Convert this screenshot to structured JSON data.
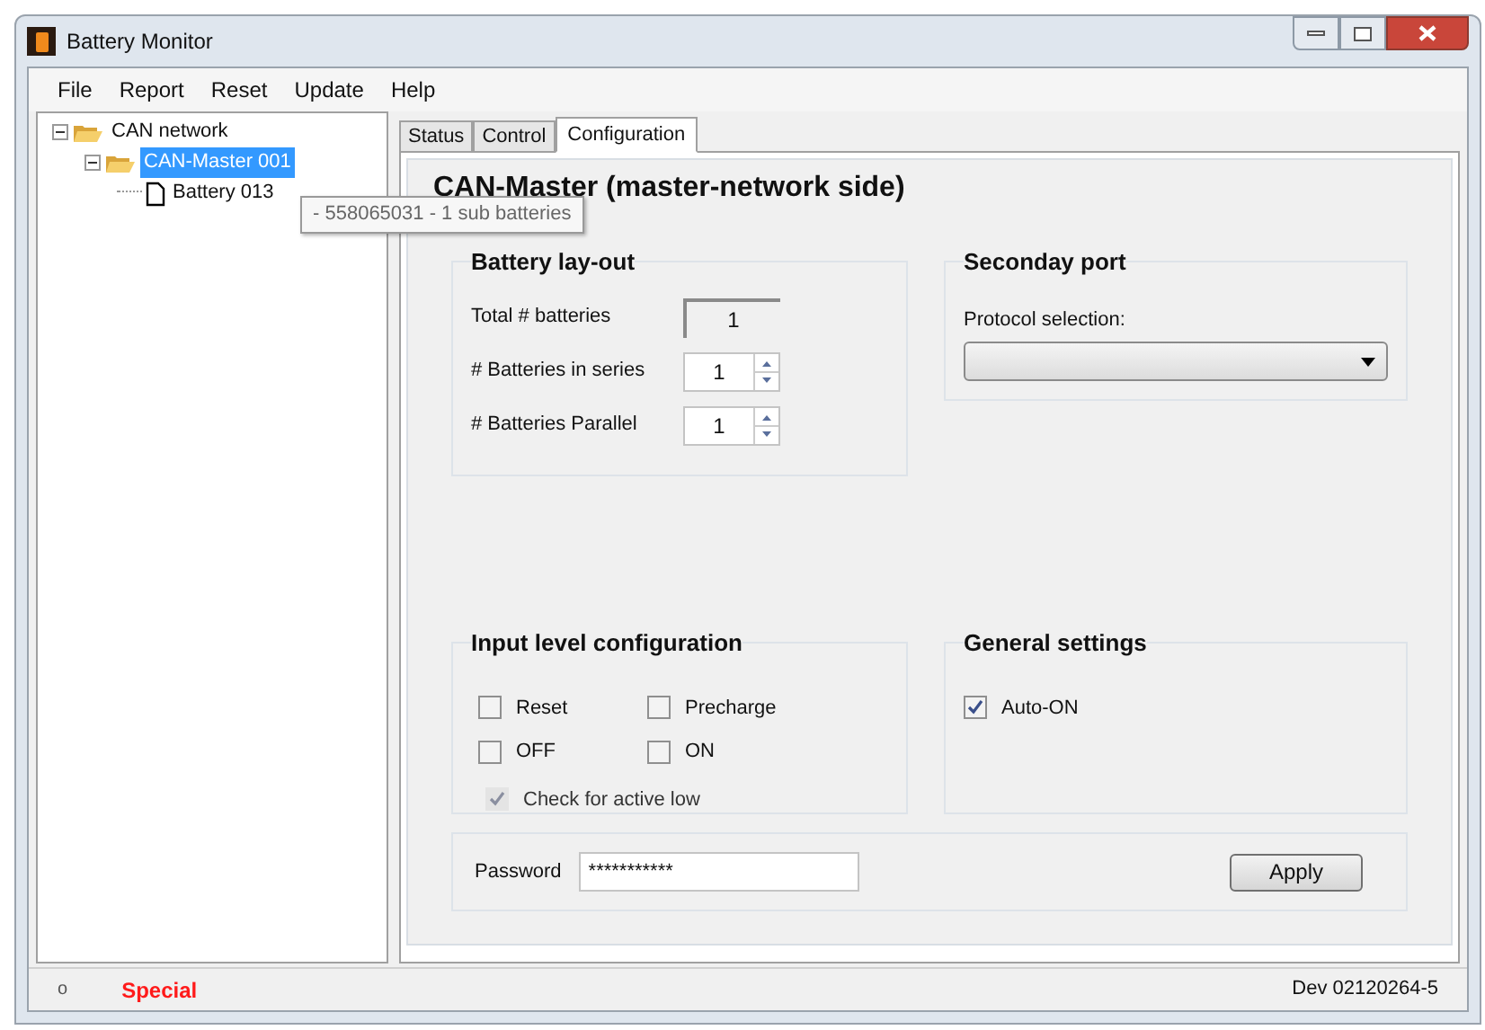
{
  "window": {
    "title": "Battery Monitor"
  },
  "menu": [
    "File",
    "Report",
    "Reset",
    "Update",
    "Help"
  ],
  "tree": [
    {
      "label": "CAN network",
      "expanded": true,
      "selected": false,
      "children": [
        {
          "label": "CAN-Master 001",
          "expanded": true,
          "selected": true,
          "children": [
            {
              "label": "Battery 013",
              "selected": false
            }
          ]
        }
      ]
    }
  ],
  "tooltip": "- 558065031 - 1 sub batteries",
  "tabs": [
    {
      "label": "Status",
      "selected": false
    },
    {
      "label": "Control",
      "selected": false
    },
    {
      "label": "Configuration",
      "selected": true
    }
  ],
  "panel_title": "CAN-Master  (master-network side)",
  "battery_layout": {
    "title": "Battery lay-out",
    "rows": [
      {
        "kind": "readonly",
        "label": "Total # batteries",
        "value": "1"
      },
      {
        "kind": "spinner",
        "label": "# Batteries in series",
        "value": "1"
      },
      {
        "kind": "spinner",
        "label": "# Batteries Parallel",
        "value": "1"
      }
    ]
  },
  "secondary_port": {
    "title": "Seconday port",
    "label": "Protocol selection:"
  },
  "input_level": {
    "title": "Input level configuration",
    "options": [
      {
        "label": "Reset",
        "checked": false,
        "disabled": false
      },
      {
        "label": "Precharge",
        "checked": false,
        "disabled": false
      },
      {
        "label": "OFF",
        "checked": false,
        "disabled": false
      },
      {
        "label": "ON",
        "checked": false,
        "disabled": false
      }
    ],
    "active_low": {
      "label": "Check for active low",
      "checked": true,
      "disabled": true
    }
  },
  "general": {
    "title": "General settings",
    "options": [
      {
        "label": "Auto-ON",
        "checked": true,
        "disabled": false
      }
    ]
  },
  "password": {
    "label": "Password",
    "value": "***********"
  },
  "apply": "Apply",
  "status_bar": {
    "indicator": "o",
    "mode": "Special",
    "device": "Dev 02120264-5"
  }
}
